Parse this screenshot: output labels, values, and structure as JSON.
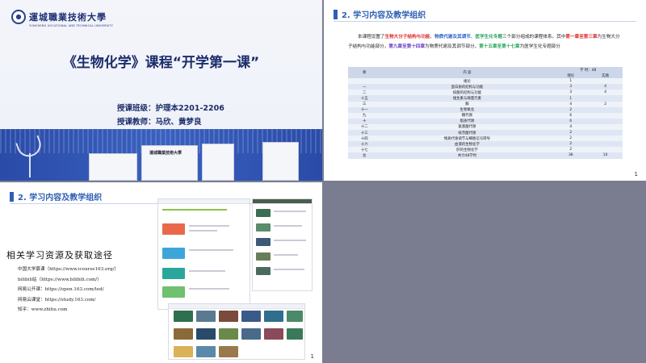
{
  "slide1": {
    "university_cn": "運城職業技術大學",
    "university_en": "YUNCHENG VOCATIONAL AND TECHNICAL UNIVERSITY",
    "title": "《生物化学》课程“开学第一课”",
    "class_label": "授课班级：护理本2201-2206",
    "teacher_label": "授课教师：马欣、黄梦良",
    "building_sign": "運城職業技術大學"
  },
  "slide2": {
    "section_title": "2. 学习内容及教学组织",
    "para": {
      "p1": "本课程设置了",
      "s1": "生物大分子结构与功能",
      "p2": "、",
      "s2": "物质代谢及其调节",
      "p3": "、",
      "s3": "医学生化专题",
      "p4": "三个部分组成的课程体系。其中",
      "s4": "第一章至第三章",
      "p5": "为生物大分子结构与功能部分，",
      "s5": "第九章至第十四章",
      "p6": "为物质代谢及其调节部分，",
      "s6": "第十五章至第十七章",
      "p7": "为医学生化专题部分"
    },
    "table": {
      "h_chapter": "章",
      "h_content": "内 容",
      "h_hours": "学 时：48",
      "h_theory": "理论",
      "h_practice": "实践",
      "rows": [
        {
          "ch": "",
          "content": "绪论",
          "t": "1",
          "p": ""
        },
        {
          "ch": "一",
          "content": "蛋白质的结构与功能",
          "t": "3",
          "p": "4"
        },
        {
          "ch": "二",
          "content": "核酸的结构与功能",
          "t": "3",
          "p": "4"
        },
        {
          "ch": "十五",
          "content": "维生素与微量元素",
          "t": "1",
          "p": ""
        },
        {
          "ch": "三",
          "content": "酶",
          "t": "4",
          "p": "2"
        },
        {
          "ch": "十一",
          "content": "生物氧化",
          "t": "2",
          "p": ""
        },
        {
          "ch": "九",
          "content": "糖代谢",
          "t": "6",
          "p": ""
        },
        {
          "ch": "十",
          "content": "脂质代谢",
          "t": "6",
          "p": ""
        },
        {
          "ch": "十二",
          "content": "氨基酸代谢",
          "t": "4",
          "p": ""
        },
        {
          "ch": "十三",
          "content": "核苷酸代谢",
          "t": "2",
          "p": ""
        },
        {
          "ch": "十四",
          "content": "物质代谢调节与细胞信号转导",
          "t": "2",
          "p": ""
        },
        {
          "ch": "十六",
          "content": "血液的生物化学",
          "t": "2",
          "p": ""
        },
        {
          "ch": "十七",
          "content": "肝的生物化学",
          "t": "2",
          "p": ""
        },
        {
          "ch": "总",
          "content": "共计48学时",
          "t": "38",
          "p": "10"
        }
      ]
    },
    "page": "1"
  },
  "slide3": {
    "section_title": "2. 学习内容及教学组织",
    "res_title": "相关学习资源及获取途径",
    "resources": [
      "中国大学慕课（https://www.icourse163.org/）",
      "bilibili站（https://www.bilibili.com/）",
      "网易公开课：https://open.163.com/ted/",
      "网易云课堂：https://study.163.com/",
      "知乎：www.zhihu.com"
    ],
    "page": "1"
  },
  "colors": {
    "accent_blue": "#2f5fb3",
    "navy": "#1c2c6b",
    "red": "#e02b2b",
    "green": "#26a65b",
    "purple": "#6a3fc4",
    "bg_gray": "#7a7d90"
  }
}
